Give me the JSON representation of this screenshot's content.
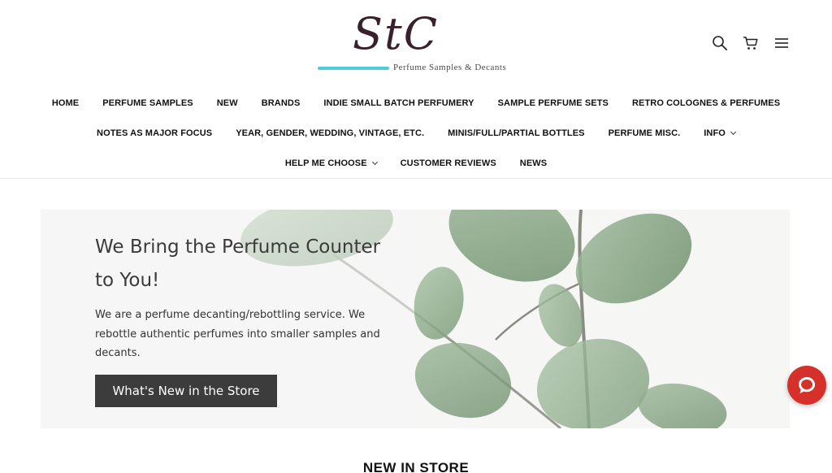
{
  "brand": {
    "logo_mark": "StC",
    "tagline": "Perfume Samples & Decants",
    "accent_color": "#4ecbdd"
  },
  "header_icons": [
    "search-icon",
    "cart-icon",
    "menu-icon"
  ],
  "nav": {
    "row1": [
      "HOME",
      "PERFUME SAMPLES",
      "NEW",
      "BRANDS",
      "INDIE SMALL BATCH PERFUMERY",
      "SAMPLE PERFUME SETS",
      "RETRO COLOGNES & PERFUMES"
    ],
    "row2": [
      "NOTES AS MAJOR FOCUS",
      "YEAR, GENDER, WEDDING, VINTAGE, ETC.",
      "MINIS/FULL/PARTIAL BOTTLES",
      "PERFUME MISC.",
      "INFO"
    ],
    "row3": [
      "HELP ME CHOOSE",
      "CUSTOMER REVIEWS",
      "NEWS"
    ]
  },
  "hero": {
    "title": "We Bring the Perfume Counter to You!",
    "body": "We are a perfume decanting/rebottling service. We rebottle authentic perfumes into smaller samples and decants.",
    "button": "What's New in the Store",
    "button_color": "#3c3c3c"
  },
  "section": {
    "title": "NEW IN STORE"
  },
  "chat_widget": {
    "icon": "chat-bubble-icon",
    "color": "#d5312a"
  }
}
